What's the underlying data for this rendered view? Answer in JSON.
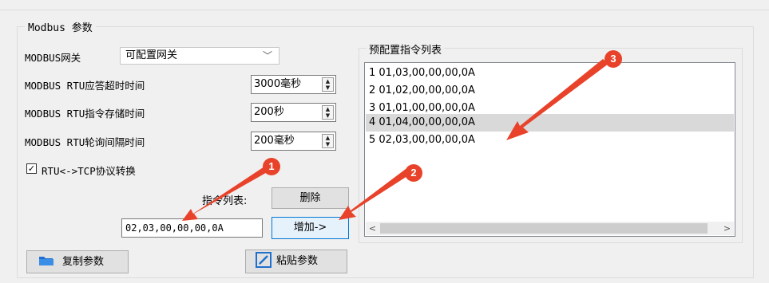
{
  "group_title": "Modbus 参数",
  "gateway": {
    "label": "MODBUS网关",
    "value": "可配置网关"
  },
  "rtu_timeout": {
    "label": "MODBUS RTU应答超时时间",
    "value": "3000毫秒"
  },
  "rtu_store": {
    "label": "MODBUS RTU指令存储时间",
    "value": "200秒"
  },
  "rtu_poll": {
    "label": "MODBUS RTU轮询间隔时间",
    "value": "200毫秒"
  },
  "rtu_tcp": {
    "label": "RTU<->TCP协议转换",
    "checked": true
  },
  "cmd_list_label": "指令列表:",
  "delete_label": "删除",
  "cmd_input_value": "02,03,00,00,00,0A",
  "add_label": "增加->",
  "preset_title": "预配置指令列表",
  "preset_items": [
    "1 01,03,00,00,00,0A",
    "2 01,02,00,00,00,0A",
    "3 01,01,00,00,00,0A",
    "4 01,04,00,00,00,0A",
    "5 02,03,00,00,00,0A"
  ],
  "copy_label": "复制参数",
  "paste_label": "粘贴参数",
  "markers": [
    "1",
    "2",
    "3"
  ],
  "colors": {
    "marker": "#e8432a",
    "selection": "#d9d9d9",
    "accent": "#0078d7"
  },
  "icons": [
    "chevron-down-icon",
    "spin-up-icon",
    "spin-down-icon",
    "checkmark-icon",
    "folder-icon",
    "paste-icon",
    "scroll-left-icon",
    "scroll-right-icon",
    "arrow-icon"
  ]
}
